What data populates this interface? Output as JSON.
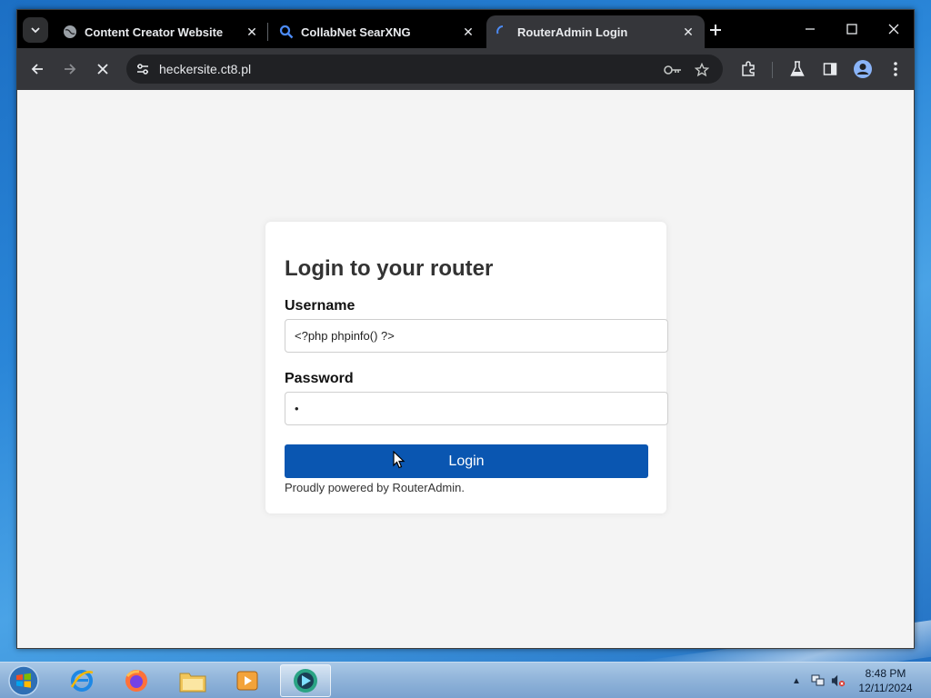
{
  "browser": {
    "tabs": [
      {
        "title": "Content Creator Website",
        "icon": "globe-icon",
        "active": false
      },
      {
        "title": "CollabNet SearXNG",
        "icon": "search-icon",
        "active": false
      },
      {
        "title": "RouterAdmin Login",
        "icon": "loading-spinner-icon",
        "active": true
      }
    ],
    "url": "heckersite.ct8.pl"
  },
  "page": {
    "heading": "Login to your router",
    "username_label": "Username",
    "username_value": "<?php phpinfo() ?>",
    "password_label": "Password",
    "password_value": "•",
    "login_button": "Login",
    "footer": "Proudly powered by RouterAdmin."
  },
  "taskbar": {
    "apps": [
      "internet-explorer",
      "firefox",
      "file-explorer",
      "media-player",
      "active-app"
    ],
    "time": "8:48 PM",
    "date": "12/11/2024"
  },
  "colors": {
    "login_button": "#0a56b1",
    "page_bg": "#f4f4f4",
    "tabstrip": "#000000",
    "toolbar": "#35363a"
  }
}
